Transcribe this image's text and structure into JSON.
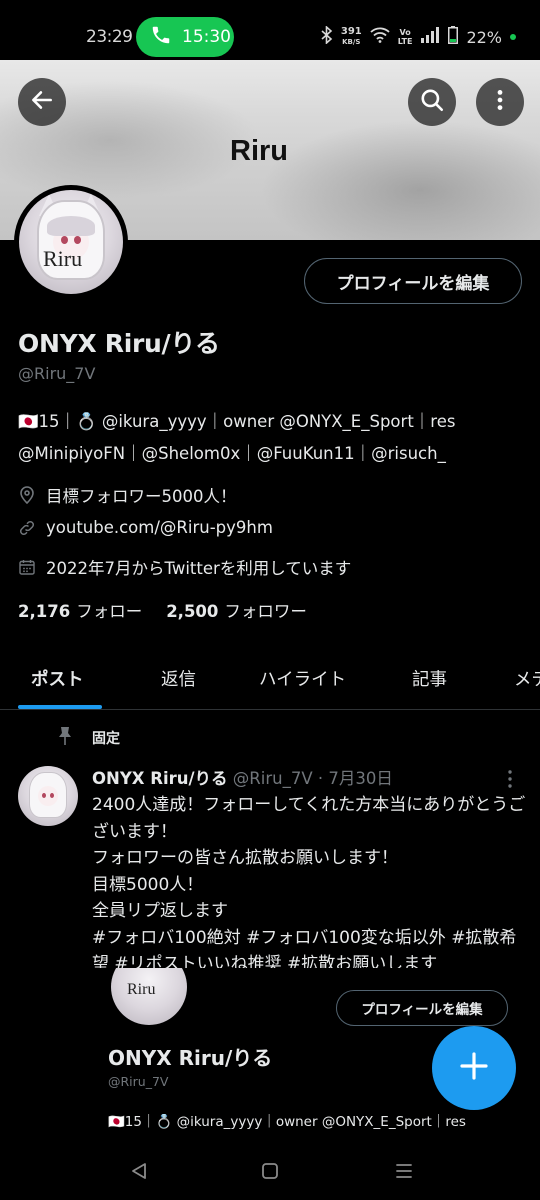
{
  "status_bar": {
    "time": "23:29",
    "call_duration": "15:30",
    "net_speed_value": "391",
    "net_speed_unit": "KB/S",
    "volte_line1": "Vo",
    "volte_line2": "LTE",
    "battery": "22%",
    "colors": {
      "call_pill": "#17c653"
    }
  },
  "header": {
    "banner_text": "Riru",
    "back_icon": "arrow-left-icon",
    "search_icon": "search-icon",
    "more_icon": "more-vertical-icon"
  },
  "profile": {
    "avatar_text": "Riru",
    "edit_button": "プロフィールを編集",
    "display_name": "ONYX Riru/りる",
    "handle": "@Riru_7V",
    "bio_line1": "🇯🇵15｜💍 @ikura_yyyy｜owner @ONYX_E_Sport｜res",
    "bio_line2": "@MinipiyoFN｜@Shelom0x｜@FuuKun11｜@risuch_",
    "location": "目標フォロワー5000人！",
    "link": "youtube.com/@Riru-py9hm",
    "joined": "2022年7月からTwitterを利用しています",
    "following_count": "2,176",
    "following_label": "フォロー",
    "followers_count": "2,500",
    "followers_label": "フォロワー"
  },
  "tabs": [
    {
      "label": "ポスト",
      "active": true
    },
    {
      "label": "返信",
      "active": false
    },
    {
      "label": "ハイライト",
      "active": false
    },
    {
      "label": "記事",
      "active": false
    },
    {
      "label": "メディア",
      "active": false
    }
  ],
  "pinned_post": {
    "pinned_label": "固定",
    "author_name": "ONYX Riru/りる",
    "author_handle": "@Riru_7V",
    "separator": "·",
    "date": "7月30日",
    "body": "2400人達成！フォローしてくれた方本当にありがとうございます！\nフォロワーの皆さん拡散お願いします！\n目標5000人！\n全員リプ返します\n#フォロバ100絶対 #フォロバ100変な垢以外 #拡散希望 #リポストいいね推奨 #拡散お願いします",
    "embed": {
      "avatar_text": "Riru",
      "edit_button": "プロフィールを編集",
      "display_name": "ONYX Riru/りる",
      "handle": "@Riru_7V",
      "bio": "🇯🇵15｜💍 @ikura_yyyy｜owner @ONYX_E_Sport｜res"
    }
  },
  "fab": {
    "icon": "plus-icon"
  },
  "nav": {
    "back": "back-triangle-icon",
    "home": "home-square-icon",
    "recents": "recents-menu-icon"
  },
  "colors": {
    "accent": "#1d9bf0",
    "background": "#000000",
    "muted_text": "#71767b"
  }
}
